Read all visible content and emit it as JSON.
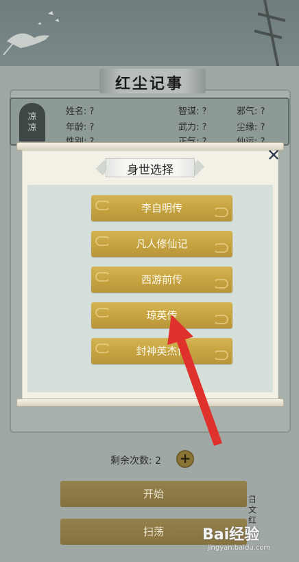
{
  "background": {
    "page_title": "红尘记事",
    "seal_text": "凉凉",
    "stats": {
      "name": "姓名: ?",
      "age": "年龄: ?",
      "gender": "性别: ?",
      "wisdom": "智谋: ?",
      "force": "武力: ?",
      "righteous": "正气: ?",
      "evil": "邪气: ?",
      "fate": "尘缘: ?",
      "immortal": "仙运: ?"
    },
    "remaining_label": "剩余次数: 2",
    "plus_label": "+",
    "start_label": "开始",
    "sweep_label": "扫荡",
    "stamp_text": "日\n文\n红"
  },
  "modal": {
    "title": "身世选择",
    "close_label": "✕",
    "options": [
      {
        "label": "李自明传"
      },
      {
        "label": "凡人修仙记"
      },
      {
        "label": "西游前传"
      },
      {
        "label": "琼英传"
      },
      {
        "label": "封神英杰传"
      }
    ]
  },
  "watermark": {
    "logo": "Bai经验",
    "url": "jingyan.baidu.com"
  },
  "colors": {
    "button_gold": "#c5a23f",
    "annotation_red": "#e0322d",
    "options_bg": "#d6e0da"
  }
}
